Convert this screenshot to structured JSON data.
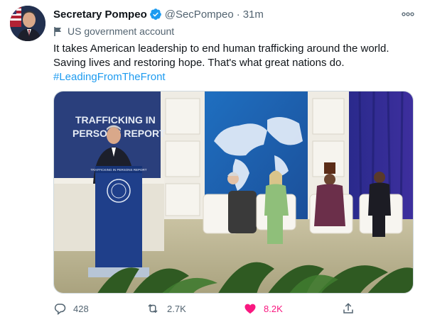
{
  "tweet": {
    "author": {
      "name": "Secretary Pompeo",
      "handle": "@SecPompeo",
      "verified": true
    },
    "separator": "·",
    "time": "31m",
    "label": "US government account",
    "text_lines": [
      "It takes American leadership to end human trafficking around the world.",
      "Saving lives and restoring hope. That's what great nations do."
    ],
    "hashtag": "#LeadingFromTheFront",
    "media": {
      "banner_text_1": "TRAFFICKING IN",
      "banner_text_2": "PERSONS REPORT",
      "podium_sign": "TRAFFICKING IN PERSONS REPORT"
    },
    "actions": {
      "replies": "428",
      "retweets": "2.7K",
      "likes": "8.2K",
      "liked": true
    }
  },
  "colors": {
    "accent": "#1d9bf0",
    "like": "#f91880",
    "secondary_text": "#536471"
  },
  "icons": [
    "verified-badge-icon",
    "more-icon",
    "government-flag-icon",
    "reply-icon",
    "retweet-icon",
    "heart-icon",
    "share-icon"
  ]
}
